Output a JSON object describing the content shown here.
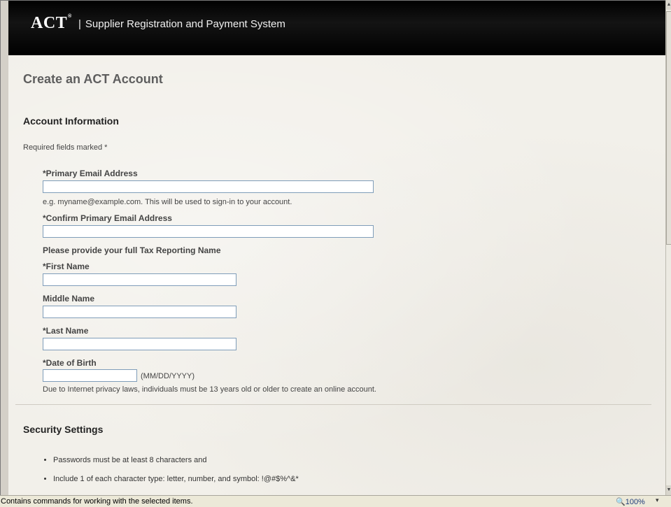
{
  "header": {
    "logo": "ACT",
    "logo_mark": "®",
    "separator": "|",
    "title": "Supplier Registration and Payment System"
  },
  "page": {
    "title": "Create an ACT Account"
  },
  "account_info": {
    "heading": "Account Information",
    "required_note": "Required fields marked *",
    "email_label": "*Primary Email Address",
    "email_value": "",
    "email_hint": "e.g. myname@example.com. This will be used to sign-in to your account.",
    "confirm_email_label": "*Confirm Primary Email Address",
    "confirm_email_value": "",
    "tax_name_heading": "Please provide your full Tax Reporting Name",
    "first_name_label": "*First Name",
    "first_name_value": "",
    "middle_name_label": "Middle Name",
    "middle_name_value": "",
    "last_name_label": "*Last Name",
    "last_name_value": "",
    "dob_label": "*Date of Birth",
    "dob_value": "",
    "dob_format": "(MM/DD/YYYY)",
    "privacy_note": "Due to Internet privacy laws, individuals must be 13 years old or older to create an online account."
  },
  "security": {
    "heading": "Security Settings",
    "rules": [
      "Passwords must be at least 8 characters and",
      "Include 1 of each character type: letter, number, and symbol: !@#$%^&*"
    ]
  },
  "statusbar": {
    "text": "Contains commands for working with the selected items.",
    "zoom": "100%",
    "zoom_icon": "magnifier-icon"
  }
}
